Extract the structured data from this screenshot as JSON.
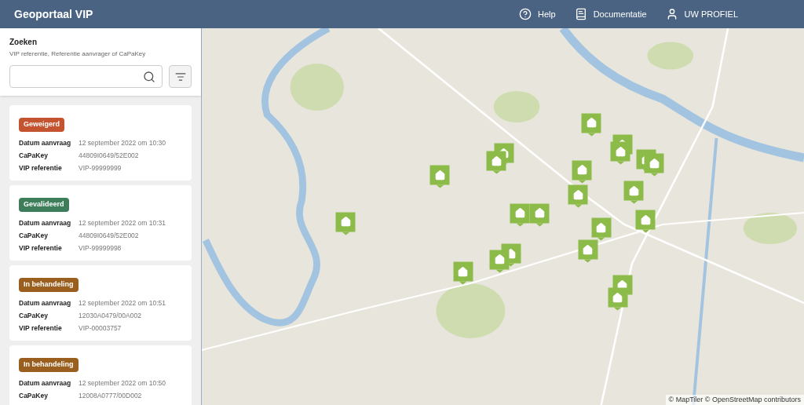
{
  "header": {
    "title": "Geoportaal VIP",
    "nav": [
      {
        "kind": "help",
        "label": "Help"
      },
      {
        "kind": "docs",
        "label": "Documentatie"
      },
      {
        "kind": "profile",
        "label": "UW PROFIEL"
      }
    ]
  },
  "search": {
    "title": "Zoeken",
    "hint": "VIP referentie, Referentie aanvrager of CaPaKey"
  },
  "cards": [
    {
      "status": "Geweigerd",
      "color": "#c4532f",
      "fields": [
        {
          "label": "Datum aanvraag",
          "value": "12 september 2022 om 10:30"
        },
        {
          "label": "CaPaKey",
          "value": "44809I0649/52E002"
        },
        {
          "label": "VIP referentie",
          "value": "VIP-99999999"
        }
      ]
    },
    {
      "status": "Gevalideerd",
      "color": "#3d7d5a",
      "fields": [
        {
          "label": "Datum aanvraag",
          "value": "12 september 2022 om 10:31"
        },
        {
          "label": "CaPaKey",
          "value": "44809I0649/52E002"
        },
        {
          "label": "VIP referentie",
          "value": "VIP-99999998"
        }
      ]
    },
    {
      "status": "In behandeling",
      "color": "#9a5f1e",
      "fields": [
        {
          "label": "Datum aanvraag",
          "value": "12 september 2022 om 10:51"
        },
        {
          "label": "CaPaKey",
          "value": "12030A0479/00A002"
        },
        {
          "label": "VIP referentie",
          "value": "VIP-00003757"
        }
      ]
    },
    {
      "status": "In behandeling",
      "color": "#9a5f1e",
      "fields": [
        {
          "label": "Datum aanvraag",
          "value": "12 september 2022 om 10:50"
        },
        {
          "label": "CaPaKey",
          "value": "12008A0777/00D002"
        }
      ]
    }
  ],
  "map": {
    "attribution": "© MapTiler © OpenStreetMap contributors"
  }
}
